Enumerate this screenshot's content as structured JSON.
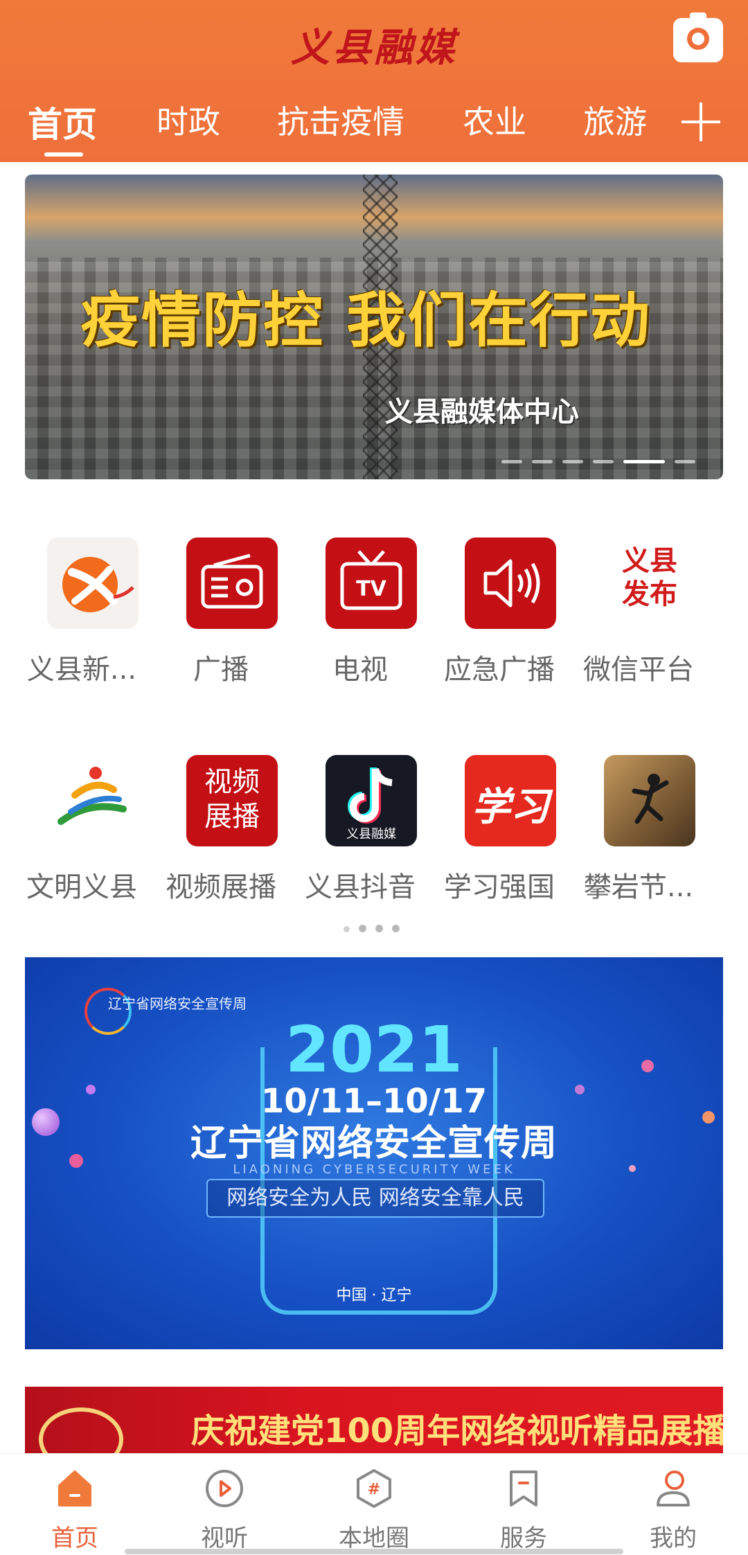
{
  "header": {
    "brand": "义县融媒",
    "tabs": [
      "首页",
      "时政",
      "抗击疫情",
      "农业",
      "旅游"
    ],
    "active_tab": "首页"
  },
  "banner": {
    "title": "疫情防控 我们在行动",
    "subtitle": "义县融媒体中心",
    "slides": 6,
    "active_slide": 5
  },
  "grid": {
    "row1": [
      {
        "label": "义县新...",
        "icon": "yixian-news-logo-icon"
      },
      {
        "label": "广播",
        "icon": "radio-icon"
      },
      {
        "label": "电视",
        "icon": "tv-icon"
      },
      {
        "label": "应急广播",
        "icon": "speaker-icon"
      },
      {
        "label": "微信平台",
        "icon": "yixian-release-logo-icon",
        "logo_text": "义县发布"
      }
    ],
    "row2": [
      {
        "label": "文明义县",
        "icon": "civilization-logo-icon"
      },
      {
        "label": "视频展播",
        "icon": "video-showcase-icon",
        "logo_text": "视频展播"
      },
      {
        "label": "义县抖音",
        "icon": "douyin-icon",
        "logo_text": "义县融媒"
      },
      {
        "label": "学习强国",
        "icon": "xuexi-icon",
        "logo_text": "学习"
      },
      {
        "label": "攀岩节...",
        "icon": "rock-climbing-icon"
      }
    ],
    "pages": 4,
    "active_page": 1
  },
  "promo": {
    "logo_text": "辽宁省网络安全宣传周",
    "year": "2021",
    "dates": "10/11–10/17",
    "title": "辽宁省网络安全宣传周",
    "english": "LIAONING CYBERSECURITY WEEK",
    "slogan": "网络安全为人民 网络安全靠人民",
    "place": "中国 · 辽宁"
  },
  "party_banner": {
    "title": "庆祝建党100周年网络视听精品展播"
  },
  "bottom_nav": [
    {
      "label": "首页",
      "icon": "home-icon",
      "active": true
    },
    {
      "label": "视听",
      "icon": "play-icon",
      "active": false
    },
    {
      "label": "本地圈",
      "icon": "hashtag-hexagon-icon",
      "active": false
    },
    {
      "label": "服务",
      "icon": "bookmark-icon",
      "active": false
    },
    {
      "label": "我的",
      "icon": "user-icon",
      "active": false
    }
  ],
  "colors": {
    "header": "#ef6f3a",
    "brand": "#c0151b",
    "icon_red": "#c40f14",
    "nav_active": "#e8603a"
  }
}
